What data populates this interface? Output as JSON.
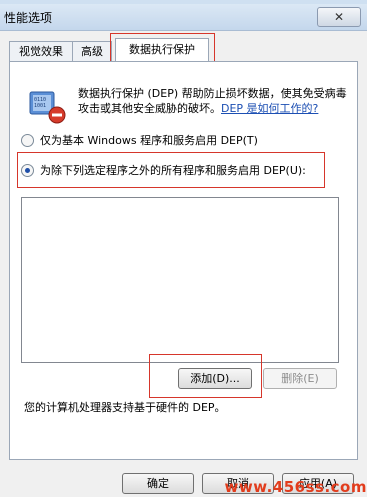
{
  "window": {
    "title": "性能选项",
    "close_glyph": "✕"
  },
  "tabs": [
    {
      "label": "视觉效果",
      "active": false
    },
    {
      "label": "高级",
      "active": false
    },
    {
      "label": "数据执行保护",
      "active": true
    }
  ],
  "dep": {
    "description": "数据执行保护 (DEP) 帮助防止损坏数据，使其免受病毒攻击或其他安全威胁的破坏。",
    "link": "DEP 是如何工作的?",
    "icon": "dep-chip-shield-icon"
  },
  "options": [
    {
      "label": "仅为基本 Windows 程序和服务启用 DEP(T)",
      "selected": false
    },
    {
      "label": "为除下列选定程序之外的所有程序和服务启用 DEP(U):",
      "selected": true
    }
  ],
  "buttons": {
    "add": "添加(D)...",
    "remove": "删除(E)"
  },
  "support_text": "您的计算机处理器支持基于硬件的 DEP。",
  "footer_buttons": {
    "ok": "确定",
    "cancel": "取消",
    "apply": "应用(A)"
  },
  "watermark": "www.456ss.com",
  "colors": {
    "highlight": "#d6362b",
    "link": "#1c4fb3",
    "watermark": "#e23c1c"
  }
}
